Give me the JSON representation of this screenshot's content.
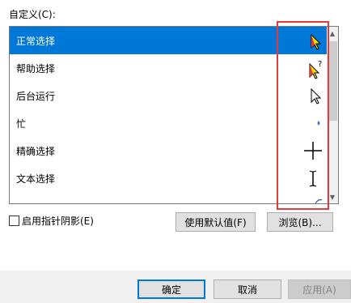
{
  "customize": {
    "label": "自定义(C):"
  },
  "pointers": [
    {
      "label": "正常选择",
      "icon": "normal-select-cursor-icon",
      "selected": true
    },
    {
      "label": "帮助选择",
      "icon": "help-select-cursor-icon",
      "selected": false
    },
    {
      "label": "后台运行",
      "icon": "working-in-background-cursor-icon",
      "selected": false
    },
    {
      "label": "忙",
      "icon": "busy-cursor-icon",
      "selected": false
    },
    {
      "label": "精确选择",
      "icon": "precision-select-cursor-icon",
      "selected": false
    },
    {
      "label": "文本选择",
      "icon": "text-select-cursor-icon",
      "selected": false
    }
  ],
  "shadow": {
    "label": "启用指针阴影(E)",
    "checked": false
  },
  "buttons": {
    "use_default": "使用默认值(F)",
    "browse": "浏览(B)...",
    "ok": "确定",
    "cancel": "取消",
    "apply": "应用(A)"
  },
  "colors": {
    "selection": "#0078d7",
    "highlight_box": "#e23b3b"
  }
}
